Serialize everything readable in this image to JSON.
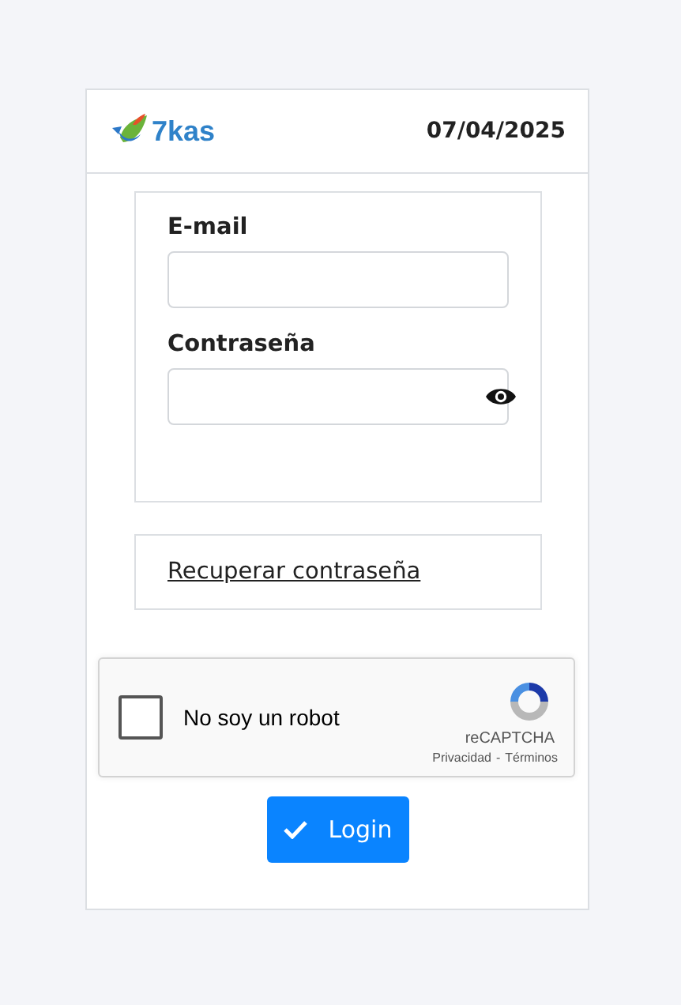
{
  "header": {
    "logo_text": "7kas",
    "date": "07/04/2025"
  },
  "form": {
    "fields": [
      {
        "label": "E-mail",
        "kind": "text"
      },
      {
        "label": "Contraseña",
        "kind": "password"
      }
    ]
  },
  "recover_link": "Recuperar contraseña",
  "captcha": {
    "checked": false,
    "label": "No soy un robot",
    "brand": "reCAPTCHA",
    "privacy": "Privacidad",
    "separator": "-",
    "terms": "Términos"
  },
  "login_button": "Login"
}
